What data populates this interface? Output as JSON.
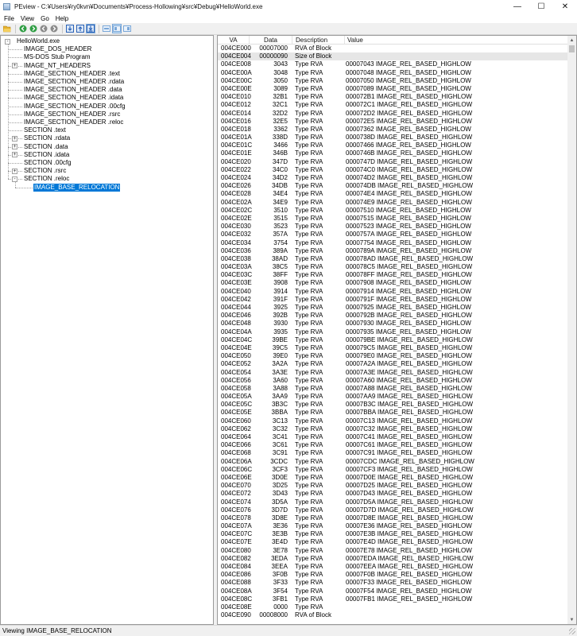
{
  "window": {
    "title": "PEview - C:¥Users¥ry0kvn¥Documents¥Process-Hollowing¥src¥Debug¥HelloWorld.exe",
    "minimize_glyph": "—",
    "maximize_glyph": "☐",
    "close_glyph": "✕"
  },
  "menu": [
    "File",
    "View",
    "Go",
    "Help"
  ],
  "toolbar": {
    "buttons": [
      {
        "name": "open-file-icon",
        "color": "#e6b12e"
      },
      {
        "name": "back-icon",
        "color": "#2f9e44"
      },
      {
        "name": "forward-icon",
        "color": "#2f9e44"
      },
      {
        "name": "previous-icon",
        "color": "#8a8a8a"
      },
      {
        "name": "next-icon",
        "color": "#8a8a8a"
      },
      {
        "name": "view-byte-icon",
        "color": "#2a62b8"
      },
      {
        "name": "view-word-icon",
        "color": "#2a62b8"
      },
      {
        "name": "view-dword-icon",
        "color": "#2a62b8"
      },
      {
        "name": "view-address-icon",
        "color": "#7aa7d8"
      },
      {
        "name": "view-save-icon",
        "color": "#7aa7d8"
      }
    ]
  },
  "tree": [
    {
      "label": "HelloWorld.exe",
      "level": 0,
      "expander": "-"
    },
    {
      "label": "IMAGE_DOS_HEADER",
      "level": 1,
      "expander": ""
    },
    {
      "label": "MS-DOS Stub Program",
      "level": 1,
      "expander": ""
    },
    {
      "label": "IMAGE_NT_HEADERS",
      "level": 1,
      "expander": "+"
    },
    {
      "label": "IMAGE_SECTION_HEADER .text",
      "level": 1,
      "expander": ""
    },
    {
      "label": "IMAGE_SECTION_HEADER .rdata",
      "level": 1,
      "expander": ""
    },
    {
      "label": "IMAGE_SECTION_HEADER .data",
      "level": 1,
      "expander": ""
    },
    {
      "label": "IMAGE_SECTION_HEADER .idata",
      "level": 1,
      "expander": ""
    },
    {
      "label": "IMAGE_SECTION_HEADER .00cfg",
      "level": 1,
      "expander": ""
    },
    {
      "label": "IMAGE_SECTION_HEADER .rsrc",
      "level": 1,
      "expander": ""
    },
    {
      "label": "IMAGE_SECTION_HEADER .reloc",
      "level": 1,
      "expander": ""
    },
    {
      "label": "SECTION .text",
      "level": 1,
      "expander": ""
    },
    {
      "label": "SECTION .rdata",
      "level": 1,
      "expander": "+"
    },
    {
      "label": "SECTION .data",
      "level": 1,
      "expander": "+"
    },
    {
      "label": "SECTION .idata",
      "level": 1,
      "expander": "+"
    },
    {
      "label": "SECTION .00cfg",
      "level": 1,
      "expander": ""
    },
    {
      "label": "SECTION .rsrc",
      "level": 1,
      "expander": "+"
    },
    {
      "label": "SECTION .reloc",
      "level": 1,
      "expander": "-"
    },
    {
      "label": "IMAGE_BASE_RELOCATION",
      "level": 2,
      "expander": "",
      "selected": true
    }
  ],
  "list": {
    "columns": [
      "VA",
      "Data",
      "Description",
      "Value"
    ],
    "rows": [
      {
        "va": "004CE000",
        "data": "00007000",
        "desc": "RVA of Block",
        "value": ""
      },
      {
        "va": "004CE004",
        "data": "00000090",
        "desc": "Size of Block",
        "value": "",
        "selected": true
      },
      {
        "va": "004CE008",
        "data": "3043",
        "desc": "Type RVA",
        "value": "00007043 IMAGE_REL_BASED_HIGHLOW"
      },
      {
        "va": "004CE00A",
        "data": "3048",
        "desc": "Type RVA",
        "value": "00007048 IMAGE_REL_BASED_HIGHLOW"
      },
      {
        "va": "004CE00C",
        "data": "3050",
        "desc": "Type RVA",
        "value": "00007050 IMAGE_REL_BASED_HIGHLOW"
      },
      {
        "va": "004CE00E",
        "data": "3089",
        "desc": "Type RVA",
        "value": "00007089 IMAGE_REL_BASED_HIGHLOW"
      },
      {
        "va": "004CE010",
        "data": "32B1",
        "desc": "Type RVA",
        "value": "000072B1 IMAGE_REL_BASED_HIGHLOW"
      },
      {
        "va": "004CE012",
        "data": "32C1",
        "desc": "Type RVA",
        "value": "000072C1 IMAGE_REL_BASED_HIGHLOW"
      },
      {
        "va": "004CE014",
        "data": "32D2",
        "desc": "Type RVA",
        "value": "000072D2 IMAGE_REL_BASED_HIGHLOW"
      },
      {
        "va": "004CE016",
        "data": "32E5",
        "desc": "Type RVA",
        "value": "000072E5 IMAGE_REL_BASED_HIGHLOW"
      },
      {
        "va": "004CE018",
        "data": "3362",
        "desc": "Type RVA",
        "value": "00007362 IMAGE_REL_BASED_HIGHLOW"
      },
      {
        "va": "004CE01A",
        "data": "338D",
        "desc": "Type RVA",
        "value": "0000738D IMAGE_REL_BASED_HIGHLOW"
      },
      {
        "va": "004CE01C",
        "data": "3466",
        "desc": "Type RVA",
        "value": "00007466 IMAGE_REL_BASED_HIGHLOW"
      },
      {
        "va": "004CE01E",
        "data": "346B",
        "desc": "Type RVA",
        "value": "0000746B IMAGE_REL_BASED_HIGHLOW"
      },
      {
        "va": "004CE020",
        "data": "347D",
        "desc": "Type RVA",
        "value": "0000747D IMAGE_REL_BASED_HIGHLOW"
      },
      {
        "va": "004CE022",
        "data": "34C0",
        "desc": "Type RVA",
        "value": "000074C0 IMAGE_REL_BASED_HIGHLOW"
      },
      {
        "va": "004CE024",
        "data": "34D2",
        "desc": "Type RVA",
        "value": "000074D2 IMAGE_REL_BASED_HIGHLOW"
      },
      {
        "va": "004CE026",
        "data": "34DB",
        "desc": "Type RVA",
        "value": "000074DB IMAGE_REL_BASED_HIGHLOW"
      },
      {
        "va": "004CE028",
        "data": "34E4",
        "desc": "Type RVA",
        "value": "000074E4 IMAGE_REL_BASED_HIGHLOW"
      },
      {
        "va": "004CE02A",
        "data": "34E9",
        "desc": "Type RVA",
        "value": "000074E9 IMAGE_REL_BASED_HIGHLOW"
      },
      {
        "va": "004CE02C",
        "data": "3510",
        "desc": "Type RVA",
        "value": "00007510 IMAGE_REL_BASED_HIGHLOW"
      },
      {
        "va": "004CE02E",
        "data": "3515",
        "desc": "Type RVA",
        "value": "00007515 IMAGE_REL_BASED_HIGHLOW"
      },
      {
        "va": "004CE030",
        "data": "3523",
        "desc": "Type RVA",
        "value": "00007523 IMAGE_REL_BASED_HIGHLOW"
      },
      {
        "va": "004CE032",
        "data": "357A",
        "desc": "Type RVA",
        "value": "0000757A IMAGE_REL_BASED_HIGHLOW"
      },
      {
        "va": "004CE034",
        "data": "3754",
        "desc": "Type RVA",
        "value": "00007754 IMAGE_REL_BASED_HIGHLOW"
      },
      {
        "va": "004CE036",
        "data": "389A",
        "desc": "Type RVA",
        "value": "0000789A IMAGE_REL_BASED_HIGHLOW"
      },
      {
        "va": "004CE038",
        "data": "38AD",
        "desc": "Type RVA",
        "value": "000078AD IMAGE_REL_BASED_HIGHLOW"
      },
      {
        "va": "004CE03A",
        "data": "38C5",
        "desc": "Type RVA",
        "value": "000078C5 IMAGE_REL_BASED_HIGHLOW"
      },
      {
        "va": "004CE03C",
        "data": "38FF",
        "desc": "Type RVA",
        "value": "000078FF IMAGE_REL_BASED_HIGHLOW"
      },
      {
        "va": "004CE03E",
        "data": "3908",
        "desc": "Type RVA",
        "value": "00007908 IMAGE_REL_BASED_HIGHLOW"
      },
      {
        "va": "004CE040",
        "data": "3914",
        "desc": "Type RVA",
        "value": "00007914 IMAGE_REL_BASED_HIGHLOW"
      },
      {
        "va": "004CE042",
        "data": "391F",
        "desc": "Type RVA",
        "value": "0000791F IMAGE_REL_BASED_HIGHLOW"
      },
      {
        "va": "004CE044",
        "data": "3925",
        "desc": "Type RVA",
        "value": "00007925 IMAGE_REL_BASED_HIGHLOW"
      },
      {
        "va": "004CE046",
        "data": "392B",
        "desc": "Type RVA",
        "value": "0000792B IMAGE_REL_BASED_HIGHLOW"
      },
      {
        "va": "004CE048",
        "data": "3930",
        "desc": "Type RVA",
        "value": "00007930 IMAGE_REL_BASED_HIGHLOW"
      },
      {
        "va": "004CE04A",
        "data": "3935",
        "desc": "Type RVA",
        "value": "00007935 IMAGE_REL_BASED_HIGHLOW"
      },
      {
        "va": "004CE04C",
        "data": "39BE",
        "desc": "Type RVA",
        "value": "000079BE IMAGE_REL_BASED_HIGHLOW"
      },
      {
        "va": "004CE04E",
        "data": "39C5",
        "desc": "Type RVA",
        "value": "000079C5 IMAGE_REL_BASED_HIGHLOW"
      },
      {
        "va": "004CE050",
        "data": "39E0",
        "desc": "Type RVA",
        "value": "000079E0 IMAGE_REL_BASED_HIGHLOW"
      },
      {
        "va": "004CE052",
        "data": "3A2A",
        "desc": "Type RVA",
        "value": "00007A2A IMAGE_REL_BASED_HIGHLOW"
      },
      {
        "va": "004CE054",
        "data": "3A3E",
        "desc": "Type RVA",
        "value": "00007A3E IMAGE_REL_BASED_HIGHLOW"
      },
      {
        "va": "004CE056",
        "data": "3A60",
        "desc": "Type RVA",
        "value": "00007A60 IMAGE_REL_BASED_HIGHLOW"
      },
      {
        "va": "004CE058",
        "data": "3A88",
        "desc": "Type RVA",
        "value": "00007A88 IMAGE_REL_BASED_HIGHLOW"
      },
      {
        "va": "004CE05A",
        "data": "3AA9",
        "desc": "Type RVA",
        "value": "00007AA9 IMAGE_REL_BASED_HIGHLOW"
      },
      {
        "va": "004CE05C",
        "data": "3B3C",
        "desc": "Type RVA",
        "value": "00007B3C IMAGE_REL_BASED_HIGHLOW"
      },
      {
        "va": "004CE05E",
        "data": "3BBA",
        "desc": "Type RVA",
        "value": "00007BBA IMAGE_REL_BASED_HIGHLOW"
      },
      {
        "va": "004CE060",
        "data": "3C13",
        "desc": "Type RVA",
        "value": "00007C13 IMAGE_REL_BASED_HIGHLOW"
      },
      {
        "va": "004CE062",
        "data": "3C32",
        "desc": "Type RVA",
        "value": "00007C32 IMAGE_REL_BASED_HIGHLOW"
      },
      {
        "va": "004CE064",
        "data": "3C41",
        "desc": "Type RVA",
        "value": "00007C41 IMAGE_REL_BASED_HIGHLOW"
      },
      {
        "va": "004CE066",
        "data": "3C61",
        "desc": "Type RVA",
        "value": "00007C61 IMAGE_REL_BASED_HIGHLOW"
      },
      {
        "va": "004CE068",
        "data": "3C91",
        "desc": "Type RVA",
        "value": "00007C91 IMAGE_REL_BASED_HIGHLOW"
      },
      {
        "va": "004CE06A",
        "data": "3CDC",
        "desc": "Type RVA",
        "value": "00007CDC IMAGE_REL_BASED_HIGHLOW"
      },
      {
        "va": "004CE06C",
        "data": "3CF3",
        "desc": "Type RVA",
        "value": "00007CF3 IMAGE_REL_BASED_HIGHLOW"
      },
      {
        "va": "004CE06E",
        "data": "3D0E",
        "desc": "Type RVA",
        "value": "00007D0E IMAGE_REL_BASED_HIGHLOW"
      },
      {
        "va": "004CE070",
        "data": "3D25",
        "desc": "Type RVA",
        "value": "00007D25 IMAGE_REL_BASED_HIGHLOW"
      },
      {
        "va": "004CE072",
        "data": "3D43",
        "desc": "Type RVA",
        "value": "00007D43 IMAGE_REL_BASED_HIGHLOW"
      },
      {
        "va": "004CE074",
        "data": "3D5A",
        "desc": "Type RVA",
        "value": "00007D5A IMAGE_REL_BASED_HIGHLOW"
      },
      {
        "va": "004CE076",
        "data": "3D7D",
        "desc": "Type RVA",
        "value": "00007D7D IMAGE_REL_BASED_HIGHLOW"
      },
      {
        "va": "004CE078",
        "data": "3D8E",
        "desc": "Type RVA",
        "value": "00007D8E IMAGE_REL_BASED_HIGHLOW"
      },
      {
        "va": "004CE07A",
        "data": "3E36",
        "desc": "Type RVA",
        "value": "00007E36 IMAGE_REL_BASED_HIGHLOW"
      },
      {
        "va": "004CE07C",
        "data": "3E3B",
        "desc": "Type RVA",
        "value": "00007E3B IMAGE_REL_BASED_HIGHLOW"
      },
      {
        "va": "004CE07E",
        "data": "3E4D",
        "desc": "Type RVA",
        "value": "00007E4D IMAGE_REL_BASED_HIGHLOW"
      },
      {
        "va": "004CE080",
        "data": "3E78",
        "desc": "Type RVA",
        "value": "00007E78 IMAGE_REL_BASED_HIGHLOW"
      },
      {
        "va": "004CE082",
        "data": "3EDA",
        "desc": "Type RVA",
        "value": "00007EDA IMAGE_REL_BASED_HIGHLOW"
      },
      {
        "va": "004CE084",
        "data": "3EEA",
        "desc": "Type RVA",
        "value": "00007EEA IMAGE_REL_BASED_HIGHLOW"
      },
      {
        "va": "004CE086",
        "data": "3F0B",
        "desc": "Type RVA",
        "value": "00007F0B IMAGE_REL_BASED_HIGHLOW"
      },
      {
        "va": "004CE088",
        "data": "3F33",
        "desc": "Type RVA",
        "value": "00007F33 IMAGE_REL_BASED_HIGHLOW"
      },
      {
        "va": "004CE08A",
        "data": "3F54",
        "desc": "Type RVA",
        "value": "00007F54 IMAGE_REL_BASED_HIGHLOW"
      },
      {
        "va": "004CE08C",
        "data": "3FB1",
        "desc": "Type RVA",
        "value": "00007FB1 IMAGE_REL_BASED_HIGHLOW"
      },
      {
        "va": "004CE08E",
        "data": "0000",
        "desc": "Type RVA",
        "value": ""
      },
      {
        "va": "004CE090",
        "data": "00008000",
        "desc": "RVA of Block",
        "value": ""
      }
    ]
  },
  "scrollbar": {
    "up_glyph": "▲",
    "down_glyph": "▼"
  },
  "status": {
    "text": "Viewing IMAGE_BASE_RELOCATION"
  },
  "colors": {
    "selection": "#0078d7",
    "row_highlight": "#e6e6e6"
  }
}
